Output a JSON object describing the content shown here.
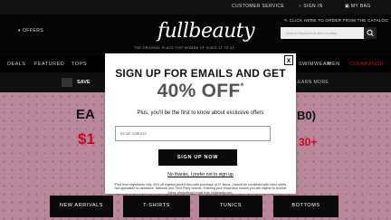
{
  "topbar": {
    "customer_service": "CUSTOMER SERVICE",
    "sign_in": "SIGN IN",
    "my_bag": "MY BAG"
  },
  "header": {
    "offers": "OFFERS",
    "logo": "fullbeauty",
    "tagline": "THE ORIGINAL PLACE FOR WOMEN OF SIZES 12 TO 44",
    "catalog_link": "CLICK HERE TO ORDER FROM THE CATALOG",
    "search_placeholder": "Search keyword or item number"
  },
  "nav": {
    "items": [
      "DEALS",
      "FEATURED",
      "TOPS",
      "SWIMWEAR",
      "MEN",
      "CLEARANCE"
    ]
  },
  "promo": {
    "save_label": "SAVE",
    "learn_more": "LEARN MORE"
  },
  "hero": {
    "headline_start": "EA",
    "headline_end": "B0)",
    "price_start": "$1",
    "price_end": "30+"
  },
  "categories": [
    "NEW ARRIVALS",
    "T-SHIRTS",
    "TUNICS",
    "BOTTOMS"
  ],
  "modal": {
    "close": "x",
    "title": "SIGN UP FOR EMAILS AND GET",
    "offer": "40% OFF",
    "offer_mark": "*",
    "subtitle": "Plus, you'll be the first to know about exclusive offers",
    "email_placeholder": "Email Address",
    "signup_button": "SIGN UP NOW",
    "no_thanks": "No thanks, I prefer not to sign up",
    "fine_print": "*First time registrants only. 40% off highest-priced item with purchase of 2+ items. Cannot be combined with other offers. Not applicable to clearance, National and Third Party brands. Entering your email also means you are eligible to receive future promotional email from fullbeauty.com."
  },
  "colors": {
    "accent_red": "#d4002a",
    "hero_pink": "#b8879a",
    "dark": "#0a0a0a"
  }
}
